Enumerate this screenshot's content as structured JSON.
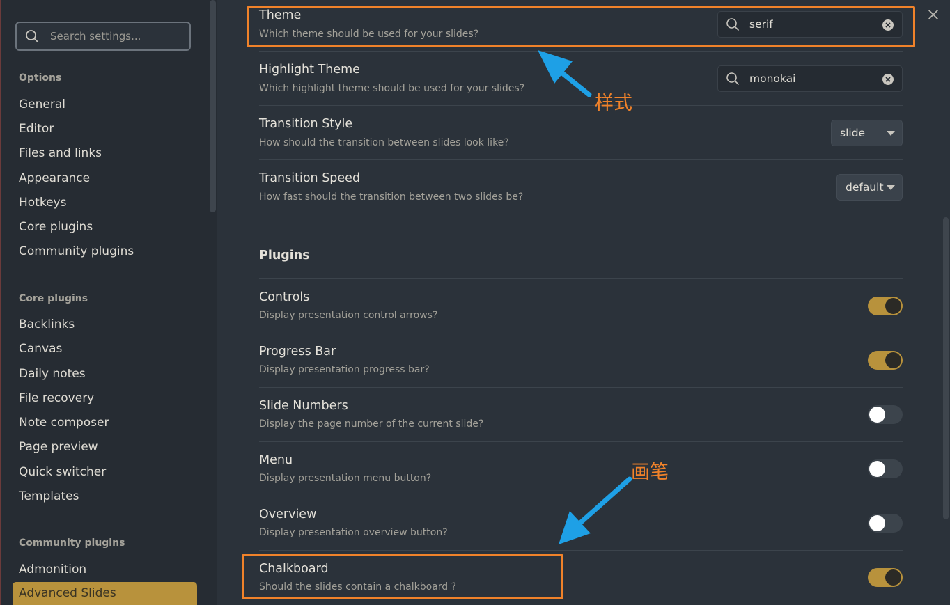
{
  "sidebar": {
    "search_placeholder": "Search settings...",
    "sections": [
      {
        "heading": "Options",
        "items": [
          "General",
          "Editor",
          "Files and links",
          "Appearance",
          "Hotkeys",
          "Core plugins",
          "Community plugins"
        ]
      },
      {
        "heading": "Core plugins",
        "items": [
          "Backlinks",
          "Canvas",
          "Daily notes",
          "File recovery",
          "Note composer",
          "Page preview",
          "Quick switcher",
          "Templates"
        ]
      },
      {
        "heading": "Community plugins",
        "items": [
          "Admonition",
          "Advanced Slides"
        ]
      }
    ],
    "active_item": "Advanced Slides"
  },
  "settings": {
    "theme": {
      "name": "Theme",
      "desc": "Which theme should be used for your slides?",
      "value": "serif"
    },
    "highlight_theme": {
      "name": "Highlight Theme",
      "desc": "Which highlight theme should be used for your slides?",
      "value": "monokai"
    },
    "transition_style": {
      "name": "Transition Style",
      "desc": "How should the transition between slides look like?",
      "value": "slide"
    },
    "transition_speed": {
      "name": "Transition Speed",
      "desc": "How fast should the transition between two slides be?",
      "value": "default"
    }
  },
  "plugins": {
    "heading": "Plugins",
    "items": [
      {
        "name": "Controls",
        "desc": "Display presentation control arrows?",
        "enabled": true
      },
      {
        "name": "Progress Bar",
        "desc": "Display presentation progress bar?",
        "enabled": true
      },
      {
        "name": "Slide Numbers",
        "desc": "Display the page number of the current slide?",
        "enabled": false
      },
      {
        "name": "Menu",
        "desc": "Display presentation menu button?",
        "enabled": false
      },
      {
        "name": "Overview",
        "desc": "Display presentation overview button?",
        "enabled": false
      },
      {
        "name": "Chalkboard",
        "desc": "Should the slides contain a chalkboard ?",
        "enabled": true
      }
    ]
  },
  "annotations": {
    "style_label": "样式",
    "brush_label": "画笔",
    "highlight_color": "#f0822a",
    "arrow_color": "#1ea0e6"
  },
  "colors": {
    "accent": "#b8923c",
    "background": "#2b323a",
    "sidebar_background": "#262c33"
  }
}
